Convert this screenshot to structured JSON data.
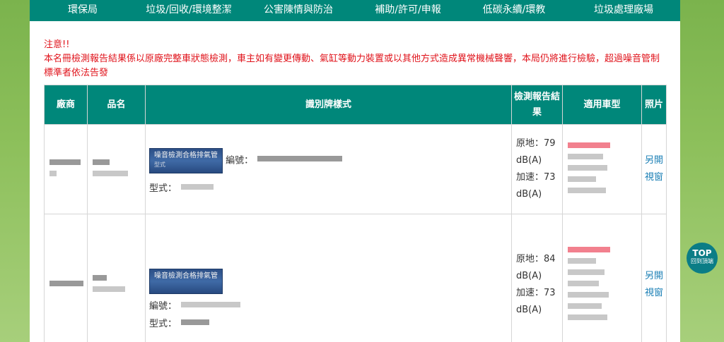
{
  "nav": {
    "items": [
      {
        "label": "環保局"
      },
      {
        "label": "垃圾/回收/環境整潔"
      },
      {
        "label": "公害陳情與防治"
      },
      {
        "label": "補助/許可/申報"
      },
      {
        "label": "低碳永續/環教"
      },
      {
        "label": "垃圾處理廠場"
      }
    ]
  },
  "notice": {
    "title": "注意!!",
    "body": "本名冊檢測報告結果係以原廠完整車狀態檢測，車主如有變更傳動、氣缸等動力裝置或以其他方式造成異常機械聲響，本局仍將進行檢驗，超過噪音管制標準者依法告發"
  },
  "table": {
    "headers": {
      "vendor": "廠商",
      "product": "品名",
      "plate_style": "識別牌樣式",
      "report_result": "檢測報告結果",
      "vehicle_type": "適用車型",
      "photo": "照片"
    },
    "rows": [
      {
        "plate_text": "噪音檢測合格排氣管",
        "plate_sub": "型式",
        "serial_label": "編號：",
        "model_label": "型式：",
        "stationary": "原地：79 dB(A)",
        "accel": "加速：73 dB(A)",
        "photo_link": "另開視窗"
      },
      {
        "plate_text": "噪音檢測合格排氣管",
        "plate_sub": "",
        "serial_label": "編號：",
        "model_label": "型式：",
        "stationary": "原地：84 dB(A)",
        "accel": "加速：73 dB(A)",
        "photo_link": "另開視窗"
      }
    ]
  },
  "top_button": {
    "label": "TOP",
    "sub": "回到頂端"
  },
  "colors": {
    "nav": "#00877a",
    "notice": "#e0131b",
    "link": "#1a7fb5",
    "top": "#0b7d86"
  }
}
